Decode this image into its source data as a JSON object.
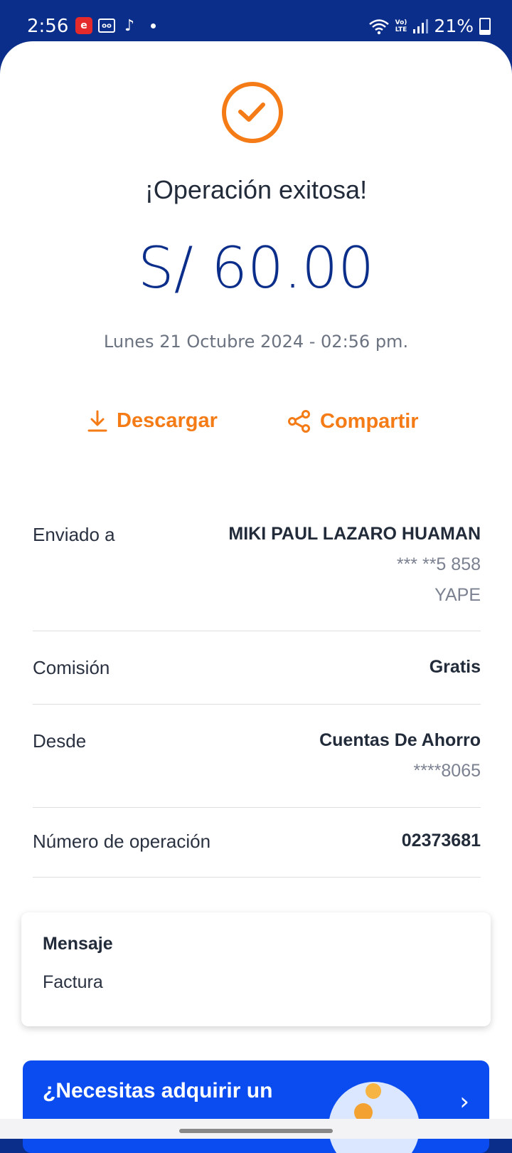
{
  "status_bar": {
    "time": "2:56",
    "battery": "21%",
    "lte_top": "Vo)",
    "lte_bottom": "LTE",
    "app_icons": [
      "e-pro-icon",
      "voicemail-icon",
      "tiktok-icon"
    ]
  },
  "result": {
    "title": "¡Operación exitosa!",
    "amount": "S/ 60.00",
    "datetime": "Lunes 21 Octubre 2024 - 02:56 pm."
  },
  "actions": {
    "download": "Descargar",
    "share": "Compartir"
  },
  "details": {
    "sent_to": {
      "label": "Enviado a",
      "name": "MIKI PAUL LAZARO HUAMAN",
      "phone": "*** **5 858",
      "app": "YAPE"
    },
    "commission": {
      "label": "Comisión",
      "value": "Gratis"
    },
    "from": {
      "label": "Desde",
      "account": "Cuentas De Ahorro",
      "number": "****8065"
    },
    "operation": {
      "label": "Número de operación",
      "value": "02373681"
    }
  },
  "message": {
    "title": "Mensaje",
    "text": "Factura"
  },
  "promo": {
    "text": "¿Necesitas adquirir un"
  },
  "colors": {
    "brand_blue": "#0b2e8a",
    "accent_orange": "#f47b16",
    "promo_blue": "#0b4cf0"
  }
}
